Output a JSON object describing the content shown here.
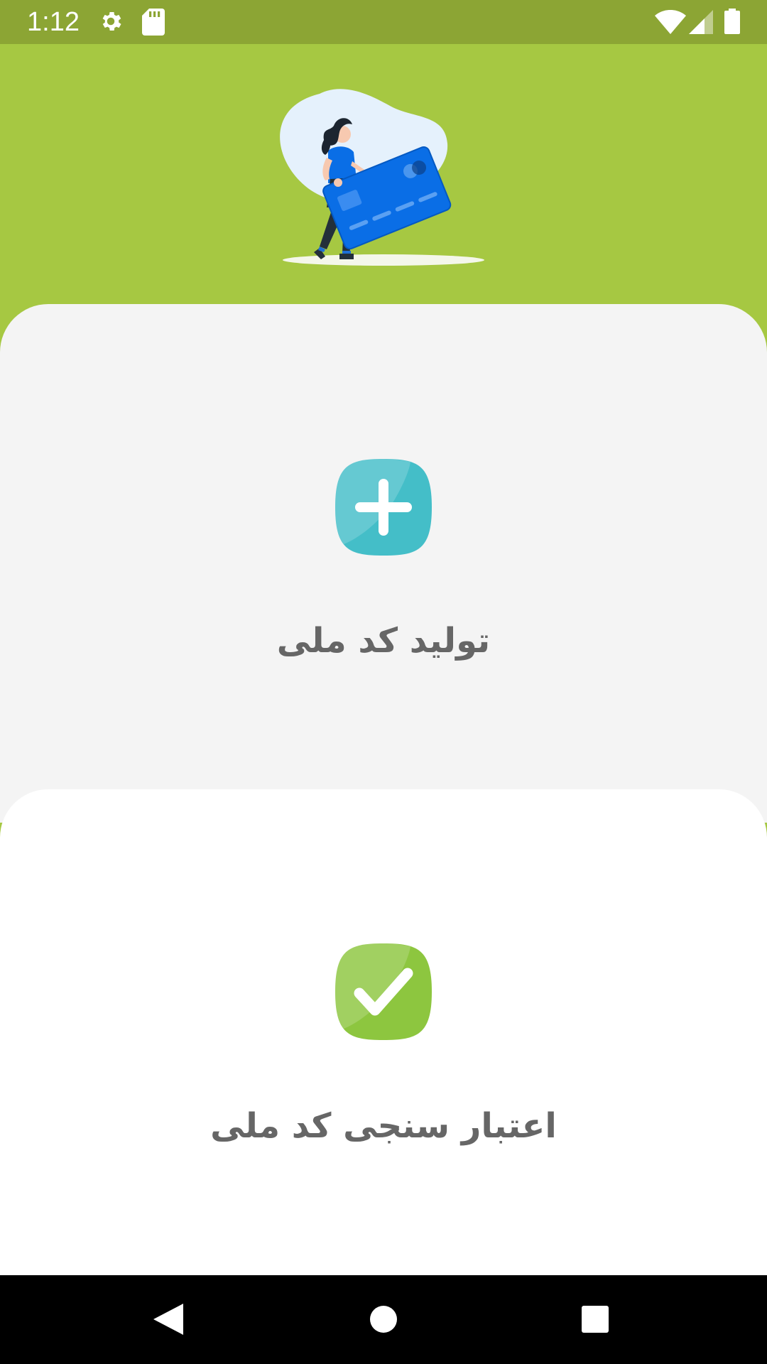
{
  "status_bar": {
    "time": "1:12",
    "icons": [
      "settings-icon",
      "sd-card-icon",
      "wifi-icon",
      "cellular-signal-icon",
      "battery-icon"
    ]
  },
  "hero": {
    "illustration": "woman-carrying-credit-card-illustration"
  },
  "cards": {
    "generate": {
      "label": "تولید کد ملی",
      "icon": "plus-icon",
      "icon_color": "#44bec8"
    },
    "validate": {
      "label": "اعتبار سنجی کد ملی",
      "icon": "checkmark-icon",
      "icon_color": "#8dc63f"
    }
  },
  "nav_bar": {
    "icons": [
      "back-icon",
      "home-icon",
      "recents-icon"
    ]
  },
  "colors": {
    "header_green": "#a6c842",
    "status_bar_green": "#8ca534",
    "card_grey": "#f4f4f4",
    "card_white": "#ffffff",
    "label_grey": "#666666"
  }
}
